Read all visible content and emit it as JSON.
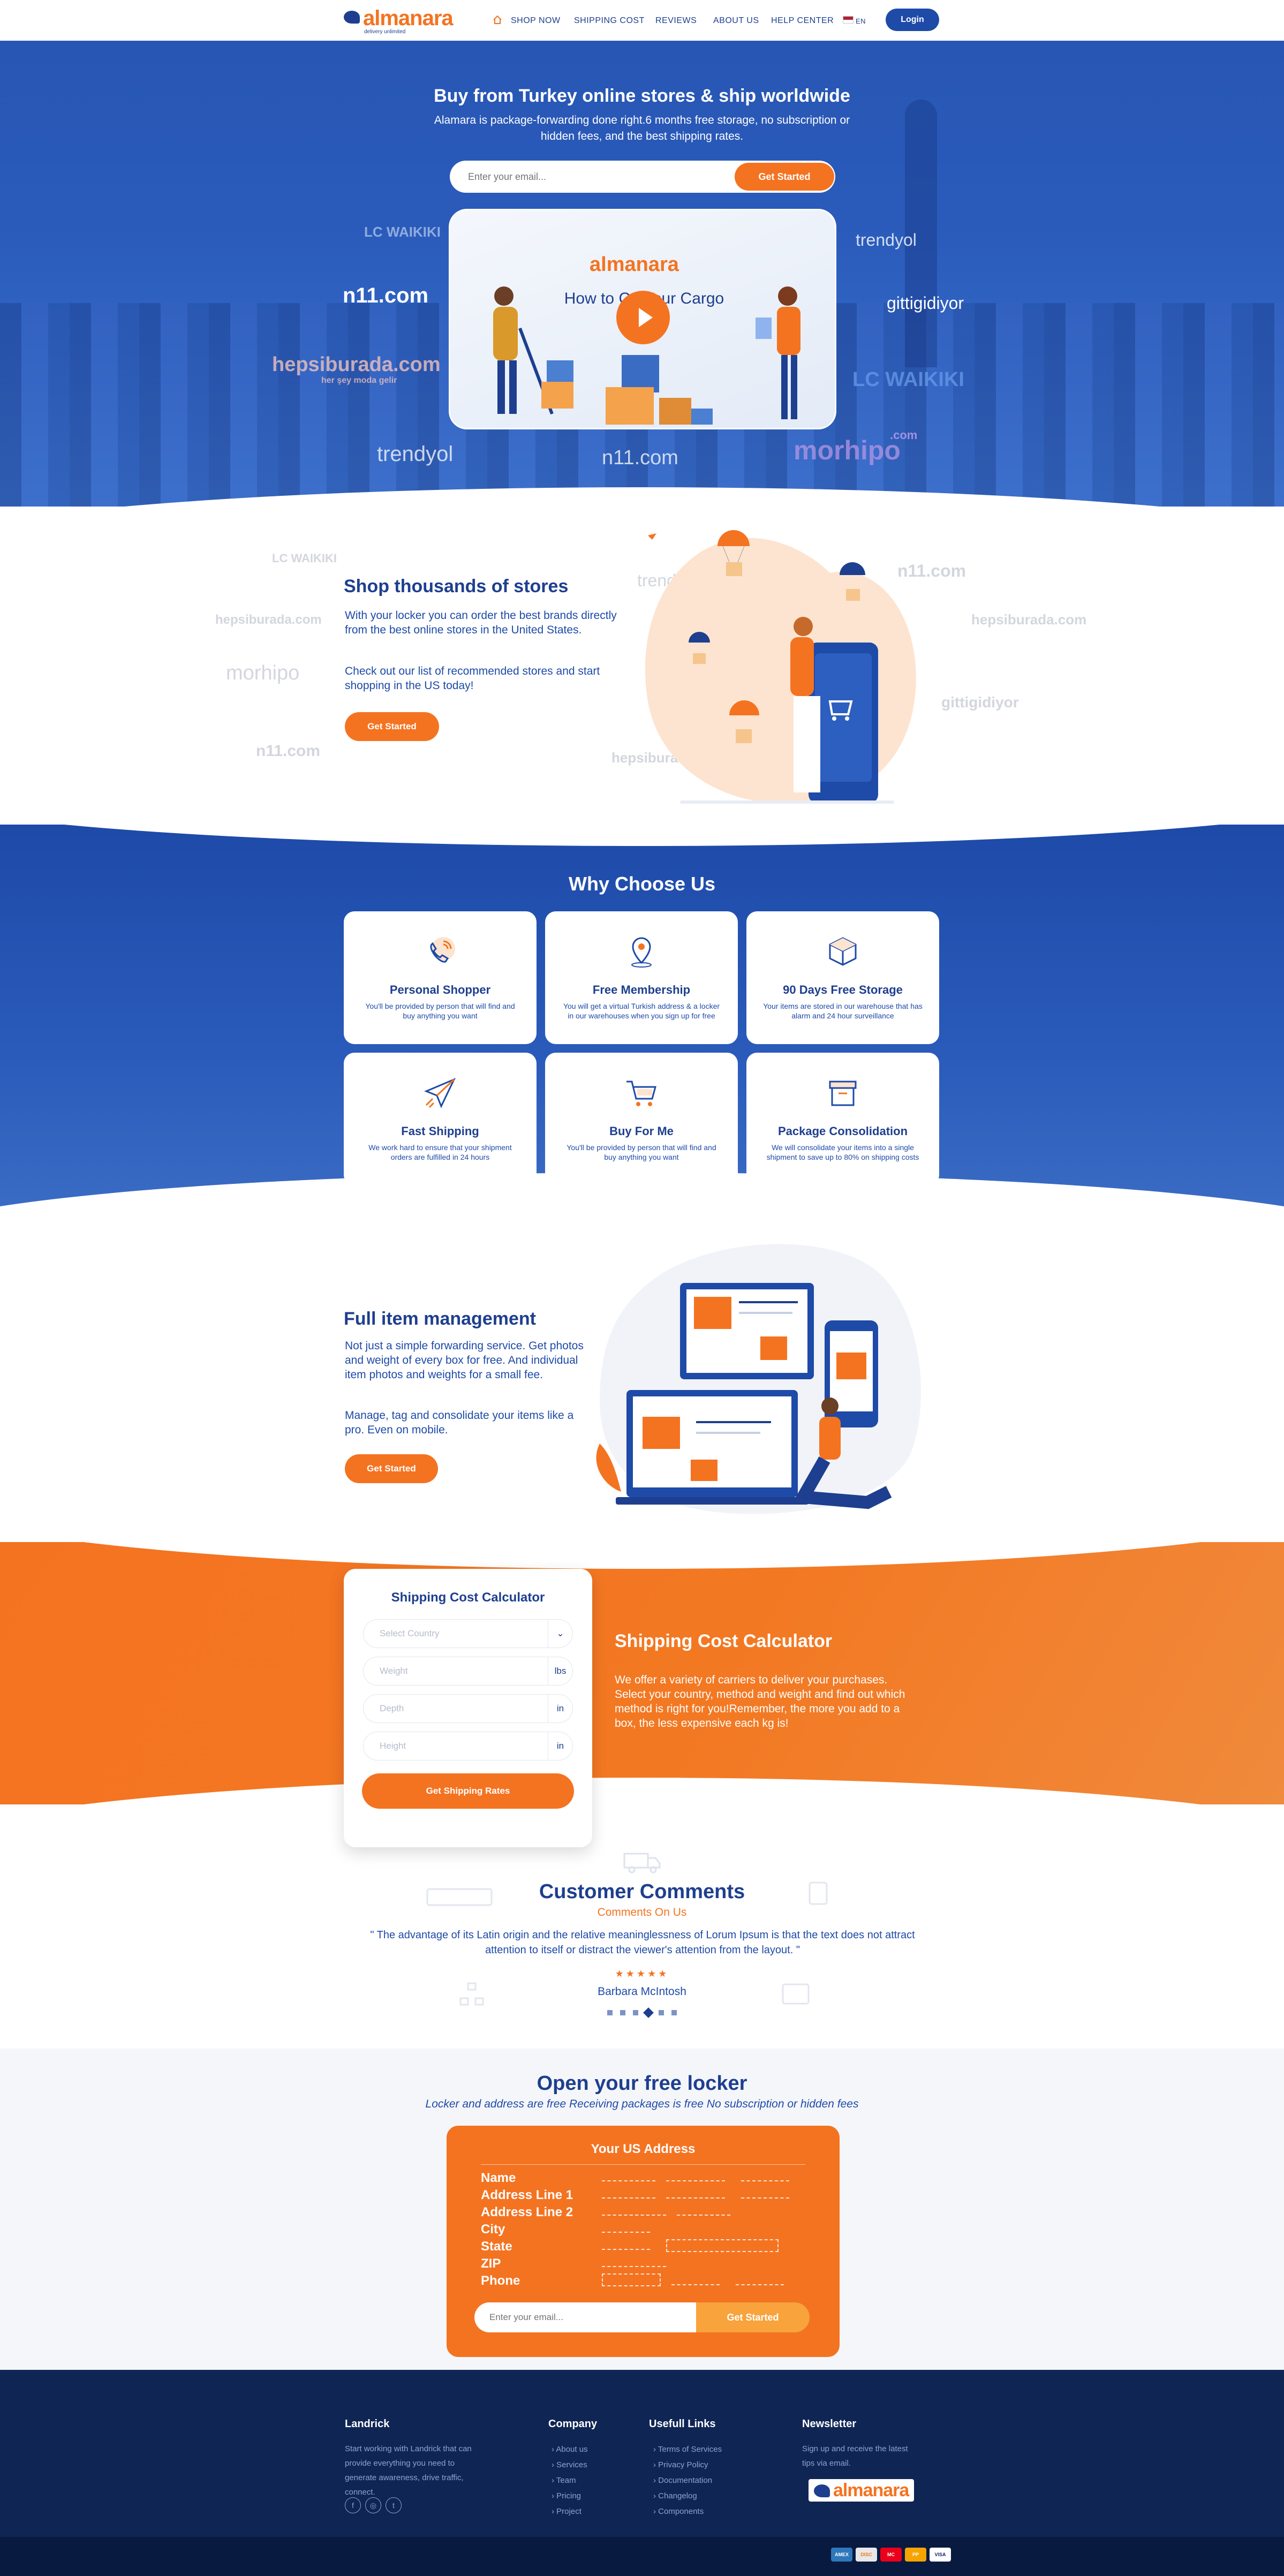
{
  "nav": {
    "logo_text": "almanara",
    "logo_tag": "delivery unlimited",
    "links": [
      "SHOP NOW",
      "SHIPPING COST",
      "REVIEWS",
      "ABOUT US",
      "HELP CENTER"
    ],
    "language": "EN",
    "login": "Login"
  },
  "hero": {
    "title": "Buy from Turkey online stores & ship worldwide",
    "subtitle": "Alamara is package-forwarding done right.6 months free storage, no subscription or hidden fees, and the best shipping rates.",
    "email_placeholder": "Enter your email...",
    "cta": "Get Started",
    "video_title": "How to Ca Your Cargo",
    "brands": [
      "LC WAIKIKI",
      "n11.com",
      "hepsiburada.com",
      "her şey moda gelir",
      "trendyol",
      "n11.com",
      "morhipo",
      ".com",
      "trendyol",
      "gittigidiyor",
      "LC WAIKIKI"
    ]
  },
  "shop": {
    "title": "Shop thousands of stores",
    "p1": "With your locker you can order the best brands directly from the best online stores in the United States.",
    "p2": "Check out our list of recommended stores and start shopping in the US today!",
    "cta": "Get Started",
    "ghost_brands": [
      "LC WAIKIKI",
      "hepsiburada.com",
      "morhipo",
      "n11.com",
      "trendyol",
      "n11.com",
      "hepsiburada.com",
      "gittigidiyor",
      "hepsiburada.com"
    ]
  },
  "why": {
    "title": "Why Choose Us",
    "cards": [
      {
        "title": "Personal Shopper",
        "desc": "You'll be provided by person that will find and buy anything you want"
      },
      {
        "title": "Free Membership",
        "desc": "You will get a virtual Turkish address & a locker in our warehouses when you sign up for free"
      },
      {
        "title": "90 Days Free Storage",
        "desc": "Your items are stored in our warehouse that has alarm and 24 hour surveillance"
      },
      {
        "title": "Fast Shipping",
        "desc": "We work hard to ensure that your shipment orders are fulfilled in 24 hours"
      },
      {
        "title": "Buy For Me",
        "desc": "You'll be provided by person that will find and buy anything you want"
      },
      {
        "title": "Package Consolidation",
        "desc": "We will consolidate your items into a single shipment to save up to 80% on shipping costs"
      }
    ]
  },
  "manage": {
    "title": "Full item management",
    "p1": "Not just a simple forwarding service. Get photos and weight of every box for free. And individual item photos and weights for a small fee.",
    "p2": "Manage, tag and consolidate your items like a pro. Even on mobile.",
    "cta": "Get Started"
  },
  "calc": {
    "card_title": "Shipping Cost Calculator",
    "country_placeholder": "Select Country",
    "weight_placeholder": "Weight",
    "weight_unit": "lbs",
    "depth_placeholder": "Depth",
    "depth_unit": "in",
    "height_placeholder": "Height",
    "height_unit": "in",
    "button": "Get Shipping Rates",
    "title": "Shipping Cost Calculator",
    "text": "We offer a variety of carriers to deliver your purchases. Select your country, method and weight and find out which method is right for you!Remember, the more you add to a box, the less expensive each kg is!"
  },
  "comments": {
    "title": "Customer Comments",
    "subtitle": "Comments On Us",
    "quote": "\" The advantage of its Latin origin and the relative meaninglessness of Lorum Ipsum is that the text does not attract attention to itself or distract the viewer's attention from the layout. \"",
    "stars": "★★★★★",
    "author": "Barbara McIntosh",
    "active_dot": 3,
    "dot_count": 6
  },
  "locker": {
    "title": "Open your free locker",
    "subtitle": "Locker and address are free Receiving packages is free No subscription or hidden fees",
    "card_title": "Your US Address",
    "fields": [
      "Name",
      "Address Line 1",
      "Address Line 2",
      "City",
      "State",
      "ZIP",
      "Phone"
    ],
    "email_placeholder": "Enter your email...",
    "cta": "Get Started"
  },
  "footer": {
    "brand": "Landrick",
    "about": "Start working with Landrick that can provide everything you need to generate awareness, drive traffic, connect.",
    "company_head": "Company",
    "company_links": [
      "About us",
      "Services",
      "Team",
      "Pricing",
      "Project"
    ],
    "useful_head": "Usefull Links",
    "useful_links": [
      "Terms of Services",
      "Privacy Policy",
      "Documentation",
      "Changelog",
      "Components"
    ],
    "newsletter_head": "Newsletter",
    "newsletter_text": "Sign up and receive the latest tips via email.",
    "social": [
      "f",
      "◎",
      "t"
    ],
    "payments": [
      "AMEX",
      "DISC",
      "MC",
      "PP",
      "VISA"
    ]
  },
  "colors": {
    "primary_blue": "#1e4aa8",
    "dark_blue": "#1e3f8f",
    "accent_orange": "#f47321",
    "footer_navy": "#0f2554"
  }
}
